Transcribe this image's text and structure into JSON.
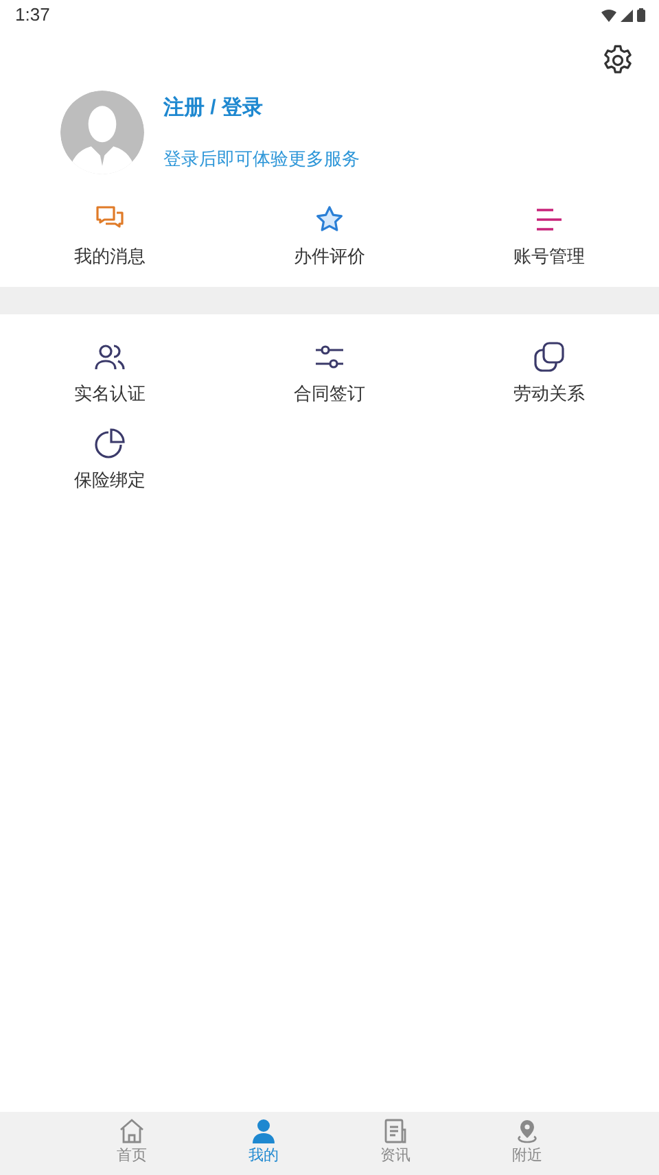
{
  "status_bar": {
    "time": "1:37"
  },
  "profile": {
    "title": "注册 / 登录",
    "subtitle": "登录后即可体验更多服务"
  },
  "quick_actions": [
    {
      "label": "我的消息"
    },
    {
      "label": "办件评价"
    },
    {
      "label": "账号管理"
    }
  ],
  "services": [
    {
      "label": "实名认证"
    },
    {
      "label": "合同签订"
    },
    {
      "label": "劳动关系"
    },
    {
      "label": "保险绑定"
    }
  ],
  "bottom_nav": [
    {
      "label": "首页",
      "selected": false
    },
    {
      "label": "我的",
      "selected": true
    },
    {
      "label": "资讯",
      "selected": false
    },
    {
      "label": "附近",
      "selected": false
    }
  ]
}
